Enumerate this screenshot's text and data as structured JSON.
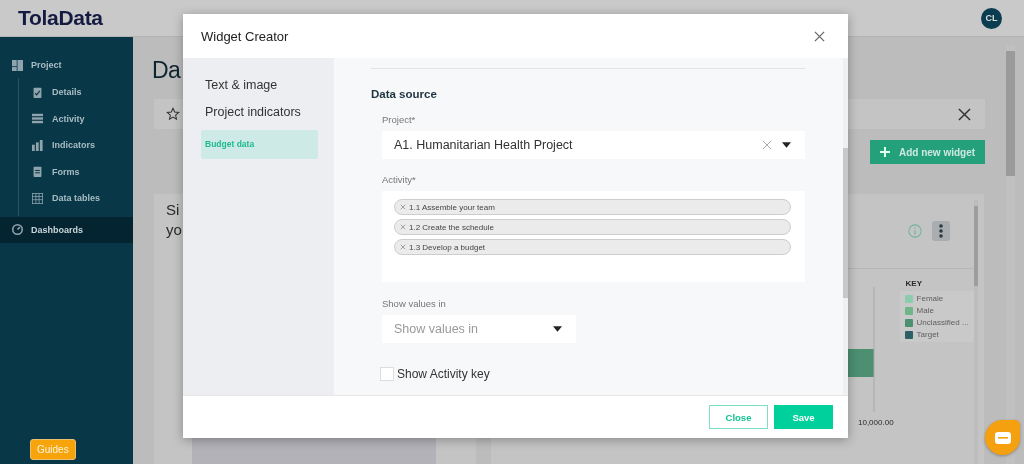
{
  "header": {
    "logo": "TolaData",
    "avatar": "CL"
  },
  "sidebar": {
    "items": [
      {
        "label": "Project",
        "selected": false,
        "children": [
          {
            "label": "Details",
            "selected": false
          },
          {
            "label": "Activity",
            "selected": false
          },
          {
            "label": "Indicators",
            "selected": false
          },
          {
            "label": "Forms",
            "selected": false
          },
          {
            "label": "Data tables",
            "selected": false
          }
        ]
      },
      {
        "label": "Dashboards",
        "selected": true
      }
    ],
    "guides_button": "Guides"
  },
  "page": {
    "title": "Da",
    "add_widget_button": "Add new widget",
    "left_card": {
      "title_lines": [
        "Si",
        "yo"
      ]
    },
    "right_card": {
      "legend_title": "KEY",
      "legend": [
        {
          "label": "Female",
          "color": "#8ccbad"
        },
        {
          "label": "Male",
          "color": "#6fb587"
        },
        {
          "label": "Unclassified ...",
          "color": "#4c8f71"
        },
        {
          "label": "Target",
          "color": "#2e5f66"
        }
      ],
      "axis_label": "10,000.00"
    }
  },
  "modal": {
    "title": "Widget Creator",
    "nav": [
      {
        "label": "Text & image",
        "selected": false
      },
      {
        "label": "Project indicators",
        "selected": false
      },
      {
        "label": "Budget data",
        "selected": true
      }
    ],
    "section_title": "Data source",
    "project_field": {
      "label": "Project*",
      "value": "A1. Humanitarian Health Project"
    },
    "activity_field": {
      "label": "Activity*",
      "tags": [
        "1.1 Assemble your team",
        "1.2 Create the schedule",
        "1.3 Develop a budget"
      ]
    },
    "values_field": {
      "label": "Show values in",
      "placeholder": "Show values in"
    },
    "activity_key": {
      "label": "Show Activity key",
      "checked": false
    },
    "buttons": [
      {
        "label": "Close",
        "kind": "secondary"
      },
      {
        "label": "Save",
        "kind": "primary"
      }
    ]
  }
}
